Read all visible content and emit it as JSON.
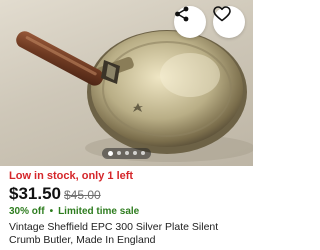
{
  "listing": {
    "stock_status": "Low in stock, only 1 left",
    "price": "$31.50",
    "original_price": "$45.00",
    "discount": "30% off",
    "separator": "•",
    "promo": "Limited time sale",
    "title": "Vintage Sheffield EPC 300 Silver Plate Silent Crumb Butler, Made In England"
  },
  "gallery": {
    "image_count": 5,
    "active_index": 0
  },
  "icons": {
    "share": "share-icon",
    "favorite": "heart-icon"
  },
  "colors": {
    "stock_red": "#d5262a",
    "promo_green": "#2e7d1f"
  }
}
